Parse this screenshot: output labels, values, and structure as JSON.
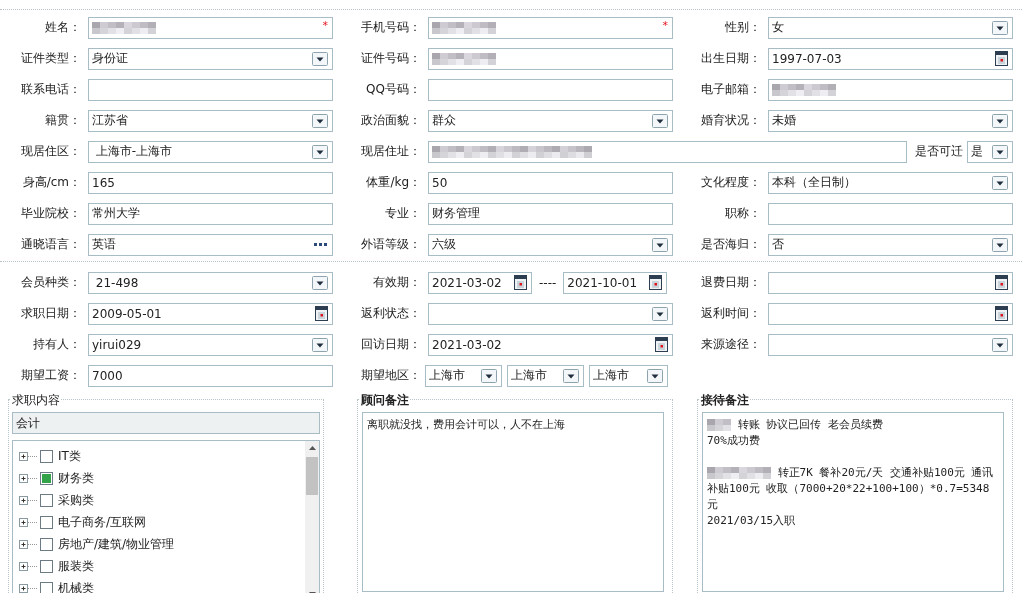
{
  "profile_rows": [
    [
      {
        "label": "姓名：",
        "kind": "text",
        "redacted": true,
        "required_mark": "*"
      },
      {
        "label": "手机号码：",
        "kind": "text",
        "redacted": true,
        "required_mark": "*"
      },
      {
        "label": "性别：",
        "kind": "select",
        "value": "女"
      }
    ],
    [
      {
        "label": "证件类型：",
        "kind": "select",
        "value": "身份证"
      },
      {
        "label": "证件号码：",
        "kind": "text",
        "redacted": true
      },
      {
        "label": "出生日期：",
        "kind": "date",
        "value": "1997-07-03"
      }
    ],
    [
      {
        "label": "联系电话：",
        "kind": "text"
      },
      {
        "label": "QQ号码：",
        "kind": "text"
      },
      {
        "label": "电子邮箱：",
        "kind": "text",
        "redacted": true
      }
    ],
    [
      {
        "label": "籍贯：",
        "kind": "select",
        "value": "江苏省"
      },
      {
        "label": "政治面貌：",
        "kind": "select",
        "value": "群众"
      },
      {
        "label": "婚育状况：",
        "kind": "select",
        "value": "未婚"
      }
    ],
    [
      {
        "label": "现居住区：",
        "kind": "select",
        "value": " 上海市-上海市"
      },
      {
        "label": "现居住址：",
        "kind": "wide_text",
        "redacted": true
      },
      {
        "label": "是否可迁",
        "kind": "compact_select",
        "value": "是"
      }
    ],
    [
      {
        "label": "身高/cm：",
        "kind": "text",
        "value": "165"
      },
      {
        "label": "体重/kg：",
        "kind": "text",
        "value": "50"
      },
      {
        "label": "文化程度：",
        "kind": "select",
        "value": "本科（全日制）"
      }
    ],
    [
      {
        "label": "毕业院校：",
        "kind": "text",
        "value": "常州大学"
      },
      {
        "label": "专业：",
        "kind": "text",
        "value": "财务管理"
      },
      {
        "label": "职称：",
        "kind": "text"
      }
    ],
    [
      {
        "label": "通晓语言：",
        "kind": "lookup",
        "value": "英语"
      },
      {
        "label": "外语等级：",
        "kind": "select",
        "value": "六级"
      },
      {
        "label": "是否海归：",
        "kind": "select",
        "value": "否"
      }
    ]
  ],
  "membership_rows": [
    [
      {
        "label": "会员种类：",
        "kind": "select",
        "value": " 21-498"
      },
      {
        "label": "有效期：",
        "kind": "date_range",
        "values": [
          "2021-03-02",
          "2021-10-01"
        ],
        "separator": "----"
      },
      {
        "label": "退费日期：",
        "kind": "date"
      }
    ],
    [
      {
        "label": "求职日期：",
        "kind": "date",
        "value": "2009-05-01"
      },
      {
        "label": "返利状态：",
        "kind": "select"
      },
      {
        "label": "返利时间：",
        "kind": "date"
      }
    ],
    [
      {
        "label": "持有人：",
        "kind": "select",
        "value": "yirui029"
      },
      {
        "label": "回访日期：",
        "kind": "date",
        "value": "2021-03-02"
      },
      {
        "label": "来源途径：",
        "kind": "select"
      }
    ],
    [
      {
        "label": "期望工资：",
        "kind": "text",
        "value": "7000"
      },
      {
        "label": "期望地区：",
        "kind": "multi_select",
        "values": [
          "上海市",
          "上海市",
          "上海市"
        ]
      }
    ]
  ],
  "job_content": {
    "title": "求职内容",
    "selected_text": "会计",
    "categories": [
      {
        "label": "IT类",
        "checked": false,
        "expanded": false
      },
      {
        "label": "财务类",
        "checked": true,
        "expanded": false
      },
      {
        "label": "采购类",
        "checked": false,
        "expanded": false
      },
      {
        "label": "电子商务/互联网",
        "checked": false,
        "expanded": false
      },
      {
        "label": "房地产/建筑/物业管理",
        "checked": false,
        "expanded": false
      },
      {
        "label": "服装类",
        "checked": false,
        "expanded": false
      },
      {
        "label": "机械类",
        "checked": false,
        "expanded": false
      }
    ]
  },
  "consultant_notes": {
    "title": "顾问备注",
    "paragraphs": [
      {
        "text": "离职就没找，费用会计可以，人不在上海"
      }
    ]
  },
  "reception_notes": {
    "title": "接待备注",
    "paragraphs": [
      {
        "redacted": true,
        "text": " 转账 协议已回传  老会员续费"
      },
      {
        "text": "70%成功费"
      },
      {
        "kind": "blank"
      },
      {
        "redacted": true,
        "text": " 转正7K 餐补20元/天 交通补贴100元 通讯补贴100元 收取（7000+20*22+100+100）*0.7=5348元"
      },
      {
        "text": "2021/03/15入职"
      }
    ]
  }
}
